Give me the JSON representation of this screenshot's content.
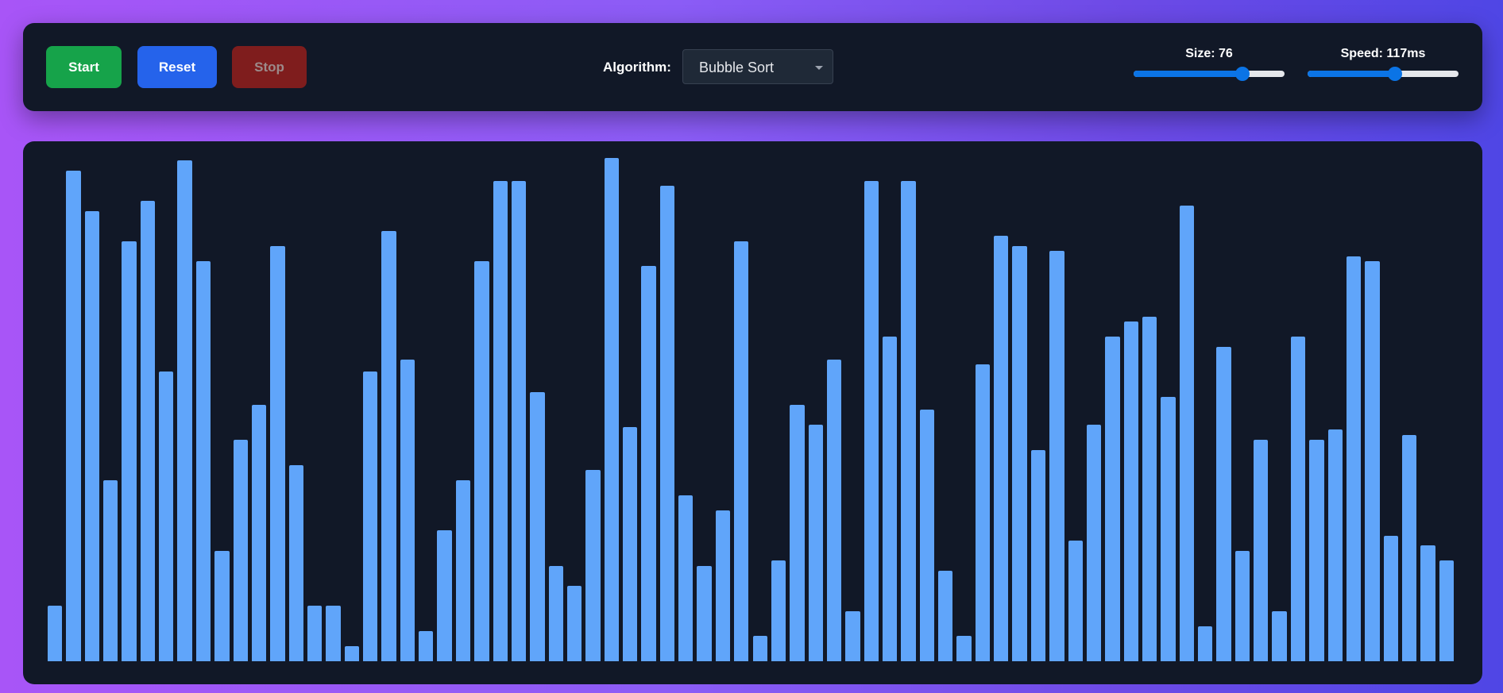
{
  "controls": {
    "start_label": "Start",
    "reset_label": "Reset",
    "stop_label": "Stop",
    "algorithm_label": "Algorithm:",
    "algorithm_selected": "Bubble Sort",
    "size_label": "Size: 76",
    "size_value_fraction": 0.72,
    "speed_label": "Speed: 117ms",
    "speed_value_fraction": 0.58
  },
  "colors": {
    "bar": "#60a5fa",
    "start": "#16a34a",
    "reset": "#2563eb",
    "stop": "#7f1d1d",
    "panel": "#111827",
    "slider": "#0b74e6"
  },
  "array": [
    0.11,
    0.975,
    0.895,
    0.36,
    0.835,
    0.915,
    0.575,
    0.995,
    0.795,
    0.22,
    0.44,
    0.51,
    0.825,
    0.39,
    0.11,
    0.11,
    0.03,
    0.575,
    0.855,
    0.6,
    0.06,
    0.26,
    0.36,
    0.795,
    0.955,
    0.955,
    0.535,
    0.19,
    0.15,
    0.38,
    1.0,
    0.465,
    0.785,
    0.945,
    0.33,
    0.19,
    0.3,
    0.835,
    0.05,
    0.2,
    0.51,
    0.47,
    0.6,
    0.1,
    0.955,
    0.645,
    0.955,
    0.5,
    0.18,
    0.05,
    0.59,
    0.845,
    0.825,
    0.42,
    0.815,
    0.24,
    0.47,
    0.645,
    0.675,
    0.685,
    0.525,
    0.905,
    0.07,
    0.625,
    0.22,
    0.44,
    0.1,
    0.645,
    0.44,
    0.46,
    0.805,
    0.795,
    0.25,
    0.45,
    0.23,
    0.2
  ]
}
